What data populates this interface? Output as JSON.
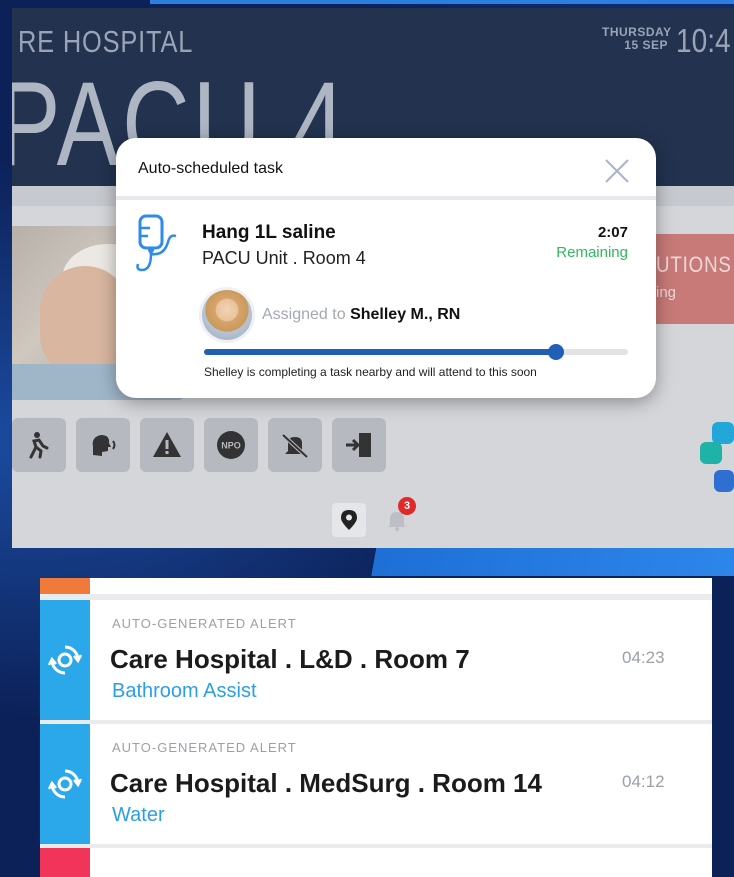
{
  "board": {
    "hospital_name": "RE HOSPITAL",
    "day": "THURSDAY",
    "date": "15 SEP",
    "time": "10:4",
    "room": "PACU 4",
    "precautions_title": "UTIONS",
    "precautions_sub": "ing",
    "status_icons": [
      "fall-risk-icon",
      "speech-icon",
      "warning-icon",
      "npo-icon",
      "no-alarm-icon",
      "exit-icon"
    ],
    "npo_label": "NPO",
    "notification_count": "3"
  },
  "modal": {
    "title": "Auto-scheduled task",
    "task_title": "Hang 1L saline",
    "task_location": "PACU Unit . Room 4",
    "timer": "2:07",
    "timer_label": "Remaining",
    "assigned_prefix": "Assigned to",
    "assigned_name": "Shelley M., RN",
    "progress": 0.83,
    "status_note": "Shelley is completing a task nearby and will attend to this soon"
  },
  "alerts": [
    {
      "kind": "AUTO-GENERATED ALERT",
      "place": "Care Hospital . L&D . Room 7",
      "request": "Bathroom Assist",
      "time": "04:23"
    },
    {
      "kind": "AUTO-GENERATED ALERT",
      "place": "Care Hospital . MedSurg . Room 14",
      "request": "Water",
      "time": "04:12"
    }
  ],
  "colors": {
    "accent_blue": "#1f5fb4",
    "remaining_green": "#2fb85c",
    "alert_stripe": "#2aa8ea",
    "alert_request": "#2a9fe6"
  }
}
